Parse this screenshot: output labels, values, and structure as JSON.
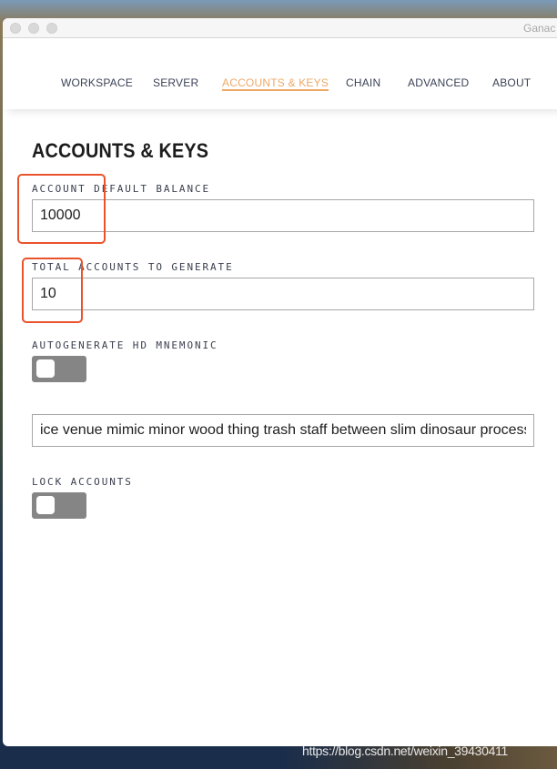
{
  "window": {
    "title": "Ganac"
  },
  "nav": {
    "items": [
      {
        "label": "WORKSPACE"
      },
      {
        "label": "SERVER"
      },
      {
        "label": "ACCOUNTS & KEYS",
        "active": true
      },
      {
        "label": "CHAIN"
      },
      {
        "label": "ADVANCED"
      },
      {
        "label": "ABOUT"
      }
    ]
  },
  "page": {
    "title": "ACCOUNTS & KEYS",
    "default_balance": {
      "label": "ACCOUNT DEFAULT BALANCE",
      "value": "10000"
    },
    "total_accounts": {
      "label": "TOTAL ACCOUNTS TO GENERATE",
      "value": "10"
    },
    "autogenerate": {
      "label": "AUTOGENERATE HD MNEMONIC",
      "on": false
    },
    "mnemonic": {
      "value": "ice venue mimic minor wood thing trash staff between slim dinosaur process"
    },
    "lock_accounts": {
      "label": "LOCK ACCOUNTS",
      "on": false
    }
  },
  "colors": {
    "accent": "#eea867",
    "annotation": "#e9532c",
    "toggle_off": "#858585"
  },
  "watermark": "https://blog.csdn.net/weixin_39430411"
}
